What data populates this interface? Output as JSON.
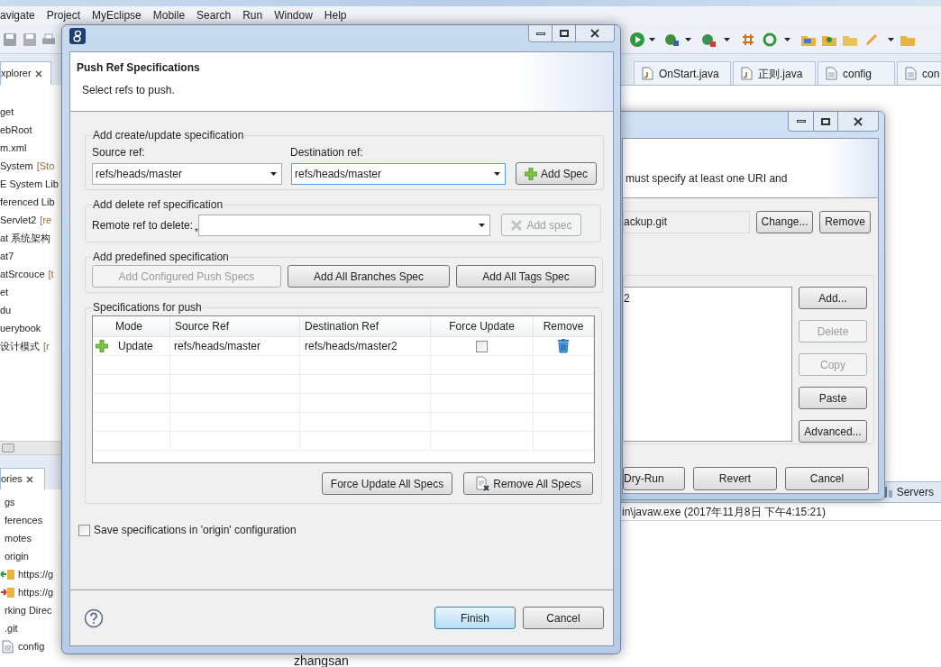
{
  "menu_bar": [
    "avigate",
    "Project",
    "MyEclipse",
    "Mobile",
    "Search",
    "Run",
    "Window",
    "Help"
  ],
  "explorer": {
    "tab": "xplorer",
    "items": [
      {
        "label": "get"
      },
      {
        "label": "ebRoot"
      },
      {
        "label": "m.xml"
      },
      {
        "label": "System",
        "decoration": "[Sto"
      },
      {
        "label": "E System Lib"
      },
      {
        "label": "ferenced Lib"
      },
      {
        "label": "Servlet2",
        "decoration": "[re"
      },
      {
        "label": "at 系统架构"
      },
      {
        "label": "at7"
      },
      {
        "label": "atSrcouce",
        "decoration": "[t"
      },
      {
        "label": "et"
      },
      {
        "label": "du"
      },
      {
        "label": "uerybook"
      },
      {
        "label": "设计模式",
        "decoration": "[r"
      }
    ]
  },
  "repositories": {
    "tab": "ories",
    "items": [
      {
        "label": "gs",
        "kind": "plain"
      },
      {
        "label": "ferences",
        "kind": "plain"
      },
      {
        "label": "motes",
        "kind": "plain"
      },
      {
        "label": "origin",
        "kind": "plain"
      },
      {
        "label": "https://g",
        "kind": "fetch"
      },
      {
        "label": "https://g",
        "kind": "push"
      },
      {
        "label": "rking Direc",
        "kind": "plain"
      },
      {
        "label": ".git",
        "kind": "plain"
      },
      {
        "label": "config",
        "kind": "file"
      }
    ]
  },
  "editor_tabs": [
    {
      "label": "OnStart.java",
      "kind": "java"
    },
    {
      "label": "正则.java",
      "kind": "java"
    },
    {
      "label": "config",
      "kind": "file"
    },
    {
      "label": "con",
      "kind": "file"
    }
  ],
  "console": {
    "tab": "Servers",
    "line": "in\\javaw.exe (2017年11月8日 下午4:15:21)"
  },
  "editor_text": "zhangsan",
  "remote_dialog": {
    "message": "must specify at least one URI and",
    "uri": "ackup.git",
    "uri_buttons": [
      "Change...",
      "Remove"
    ],
    "spec_list": [
      "2"
    ],
    "side_buttons": [
      {
        "label": "Add...",
        "disabled": false
      },
      {
        "label": "Delete",
        "disabled": true
      },
      {
        "label": "Copy",
        "disabled": true
      },
      {
        "label": "Paste",
        "disabled": false
      },
      {
        "label": "Advanced...",
        "disabled": false
      }
    ],
    "buttons": [
      "Dry-Run",
      "Revert",
      "Cancel"
    ]
  },
  "push_dialog": {
    "title": "Push Ref Specifications",
    "description": "Select refs to push.",
    "create_group": {
      "legend": "Add create/update specification",
      "source_label": "Source ref:",
      "source_value": "refs/heads/master",
      "destination_label": "Destination ref:",
      "destination_value": "refs/heads/master",
      "button": {
        "label": "Add Spec",
        "disabled": false
      }
    },
    "delete_group": {
      "legend": "Add delete ref specification",
      "label": "Remote ref to delete:",
      "required_marker": "*",
      "button": {
        "label": "Add spec",
        "disabled": true
      }
    },
    "predefined_group": {
      "legend": "Add predefined specification",
      "buttons": [
        {
          "label": "Add Configured Push Specs",
          "disabled": true
        },
        {
          "label": "Add All Branches Spec",
          "disabled": false
        },
        {
          "label": "Add All Tags Spec",
          "disabled": false
        }
      ]
    },
    "specs_group": {
      "legend": "Specifications for push",
      "columns": [
        "Mode",
        "Source Ref",
        "Destination Ref",
        "Force Update",
        "Remove"
      ],
      "rows": [
        {
          "mode": "Update",
          "source": "refs/heads/master",
          "destination": "refs/heads/master2",
          "force_update": false
        }
      ],
      "buttons": [
        "Force Update All Specs",
        "Remove All Specs"
      ]
    },
    "save_checkbox": {
      "label": "Save specifications in 'origin' configuration",
      "checked": false
    },
    "footer_buttons": [
      {
        "label": "Finish",
        "default": true
      },
      {
        "label": "Cancel",
        "default": false
      }
    ]
  }
}
